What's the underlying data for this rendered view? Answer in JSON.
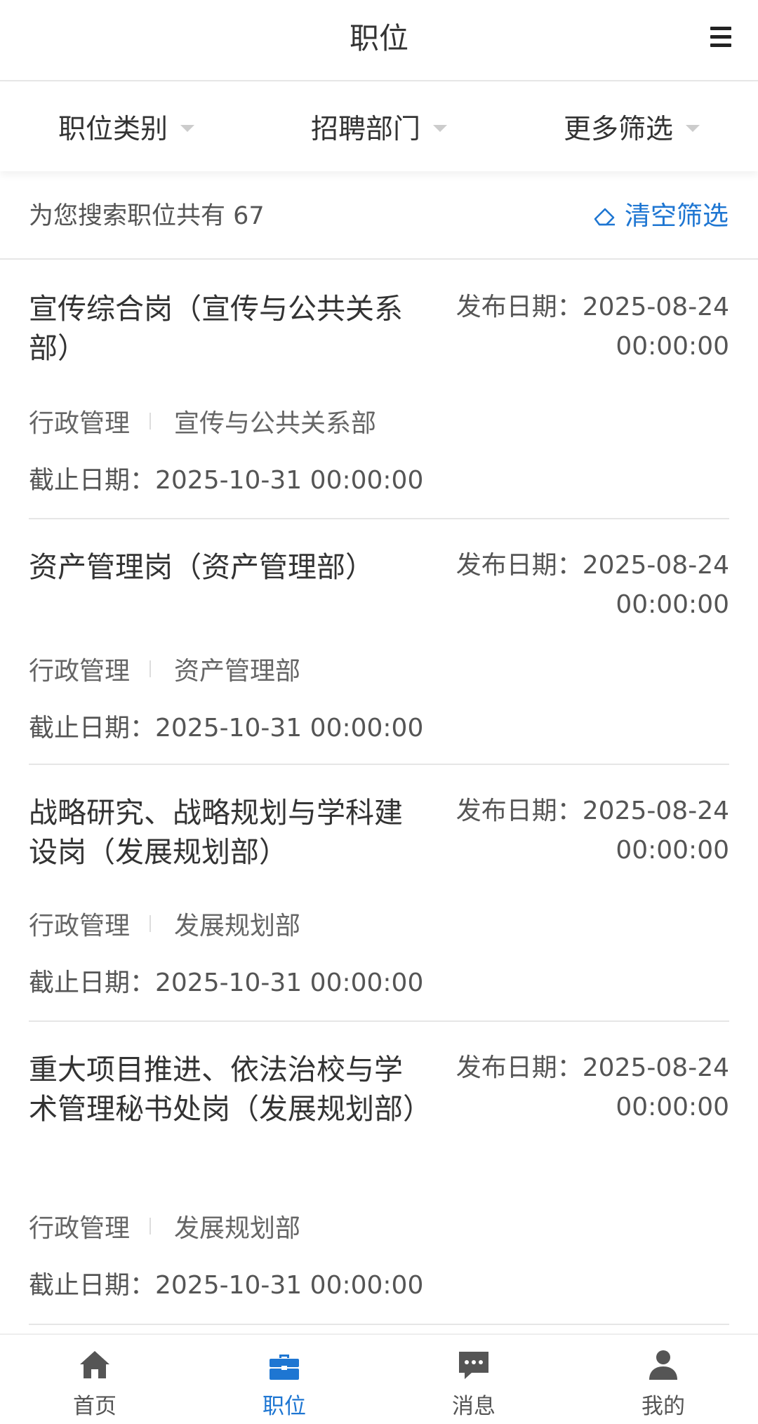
{
  "header": {
    "title": "职位"
  },
  "filters": [
    {
      "label": "职位类别"
    },
    {
      "label": "招聘部门"
    },
    {
      "label": "更多筛选"
    }
  ],
  "summary": {
    "count_text": "为您搜索职位共有 67",
    "clear_label": "清空筛选"
  },
  "jobs": [
    {
      "title": "宣传综合岗（宣传与公共关系部）",
      "publish": "发布日期：2025-08-24 00:00:00",
      "category": "行政管理",
      "department": "宣传与公共关系部",
      "deadline": "截止日期：2025-10-31 00:00:00"
    },
    {
      "title": "资产管理岗（资产管理部）",
      "publish": "发布日期：2025-08-24 00:00:00",
      "category": "行政管理",
      "department": "资产管理部",
      "deadline": "截止日期：2025-10-31 00:00:00"
    },
    {
      "title": "战略研究、战略规划与学科建设岗（发展规划部）",
      "publish": "发布日期：2025-08-24 00:00:00",
      "category": "行政管理",
      "department": "发展规划部",
      "deadline": "截止日期：2025-10-31 00:00:00"
    },
    {
      "title": "重大项目推进、依法治校与学术管理秘书处岗（发展规划部）",
      "publish": "发布日期：2025-08-24 00:00:00",
      "category": "行政管理",
      "department": "发展规划部",
      "deadline": "截止日期：2025-10-31 00:00:00"
    }
  ],
  "tabbar": [
    {
      "label": "首页",
      "icon": "home-icon"
    },
    {
      "label": "职位",
      "icon": "briefcase-icon",
      "active": true
    },
    {
      "label": "消息",
      "icon": "chat-icon"
    },
    {
      "label": "我的",
      "icon": "user-icon"
    }
  ],
  "colors": {
    "accent": "#1e76d2",
    "inactive": "#555555"
  }
}
